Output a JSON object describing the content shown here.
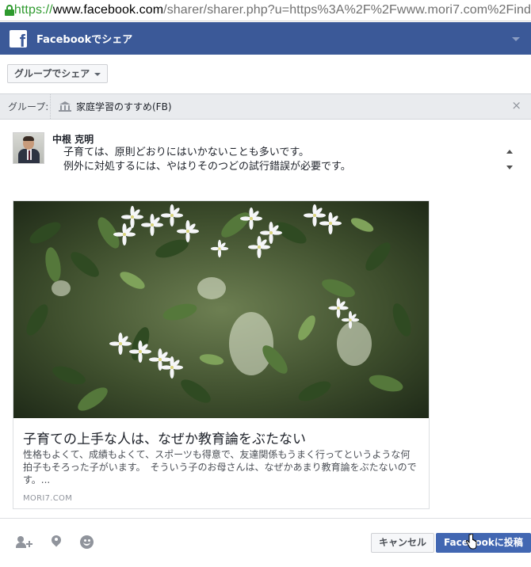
{
  "browser": {
    "url_scheme": "https://",
    "url_host": "www.facebook.com",
    "url_rest": "/sharer/sharer.php?u=https%3A%2F%2Fwww.mori7.com%2Find"
  },
  "header": {
    "logo_letter": "f",
    "title": "Facebookでシェア"
  },
  "share_to": {
    "selected": "グループでシェア"
  },
  "group_bar": {
    "label": "グループ:",
    "group_name": "家庭学習のすすめ(FB)",
    "close": "×"
  },
  "composer": {
    "user_name": "中根 克明",
    "message_line1": "子育ては、原則どおりにはいかないことも多いです。",
    "message_line2": "例外に対処するには、やはりそのつどの試行錯誤が必要です。"
  },
  "preview": {
    "title": "子育ての上手な人は、なぜか教育論をぶたない",
    "description": "性格もよくて、成績もよくて、スポーツも得意で、友達関係もうまく行ってというような何拍子もそろった子がいます。　そういう子のお母さんは、なぜかあまり教育論をぶたないのです。...",
    "domain": "MORI7.COM"
  },
  "footer": {
    "cancel_label": "キャンセル",
    "post_label": "Facebookに投稿"
  },
  "colors": {
    "fb_blue": "#3b5998",
    "button_blue": "#4267b2",
    "secure_green": "#2e9a2e"
  },
  "icons": [
    "lock-icon",
    "facebook-logo-icon",
    "chevron-down-icon",
    "group-building-icon",
    "close-icon",
    "tag-people-icon",
    "location-pin-icon",
    "feeling-smiley-icon"
  ]
}
